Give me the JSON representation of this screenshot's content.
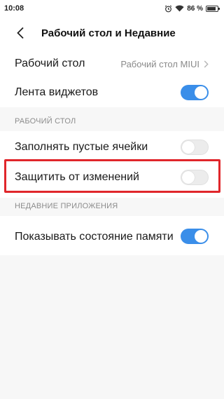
{
  "status_bar": {
    "time": "10:08",
    "battery_percent": "86 %",
    "battery_level": 0.86,
    "icons": [
      "alarm-icon",
      "wifi-icon",
      "battery-icon"
    ]
  },
  "header": {
    "back_icon": "chevron-left-icon",
    "title": "Рабочий стол и Недавние"
  },
  "group1": {
    "desktop": {
      "label": "Рабочий стол",
      "value": "Рабочий стол MIUI",
      "icon": "chevron-right-icon"
    },
    "widget_feed": {
      "label": "Лента виджетов",
      "enabled": true
    }
  },
  "section_desktop": {
    "header": "РАБОЧИЙ СТОЛ",
    "fill_empty_cells": {
      "label": "Заполнять пустые ячейки",
      "enabled": false
    },
    "protect_changes": {
      "label": "Защитить от изменений",
      "enabled": false
    }
  },
  "section_recent": {
    "header": "НЕДАВНИЕ ПРИЛОЖЕНИЯ",
    "show_memory": {
      "label": "Показывать состояние памяти",
      "enabled": true
    }
  },
  "colors": {
    "accent": "#3a8ee9",
    "highlight": "#e0262b",
    "background": "#f7f7f7",
    "secondary_text": "#8c8c8c"
  }
}
